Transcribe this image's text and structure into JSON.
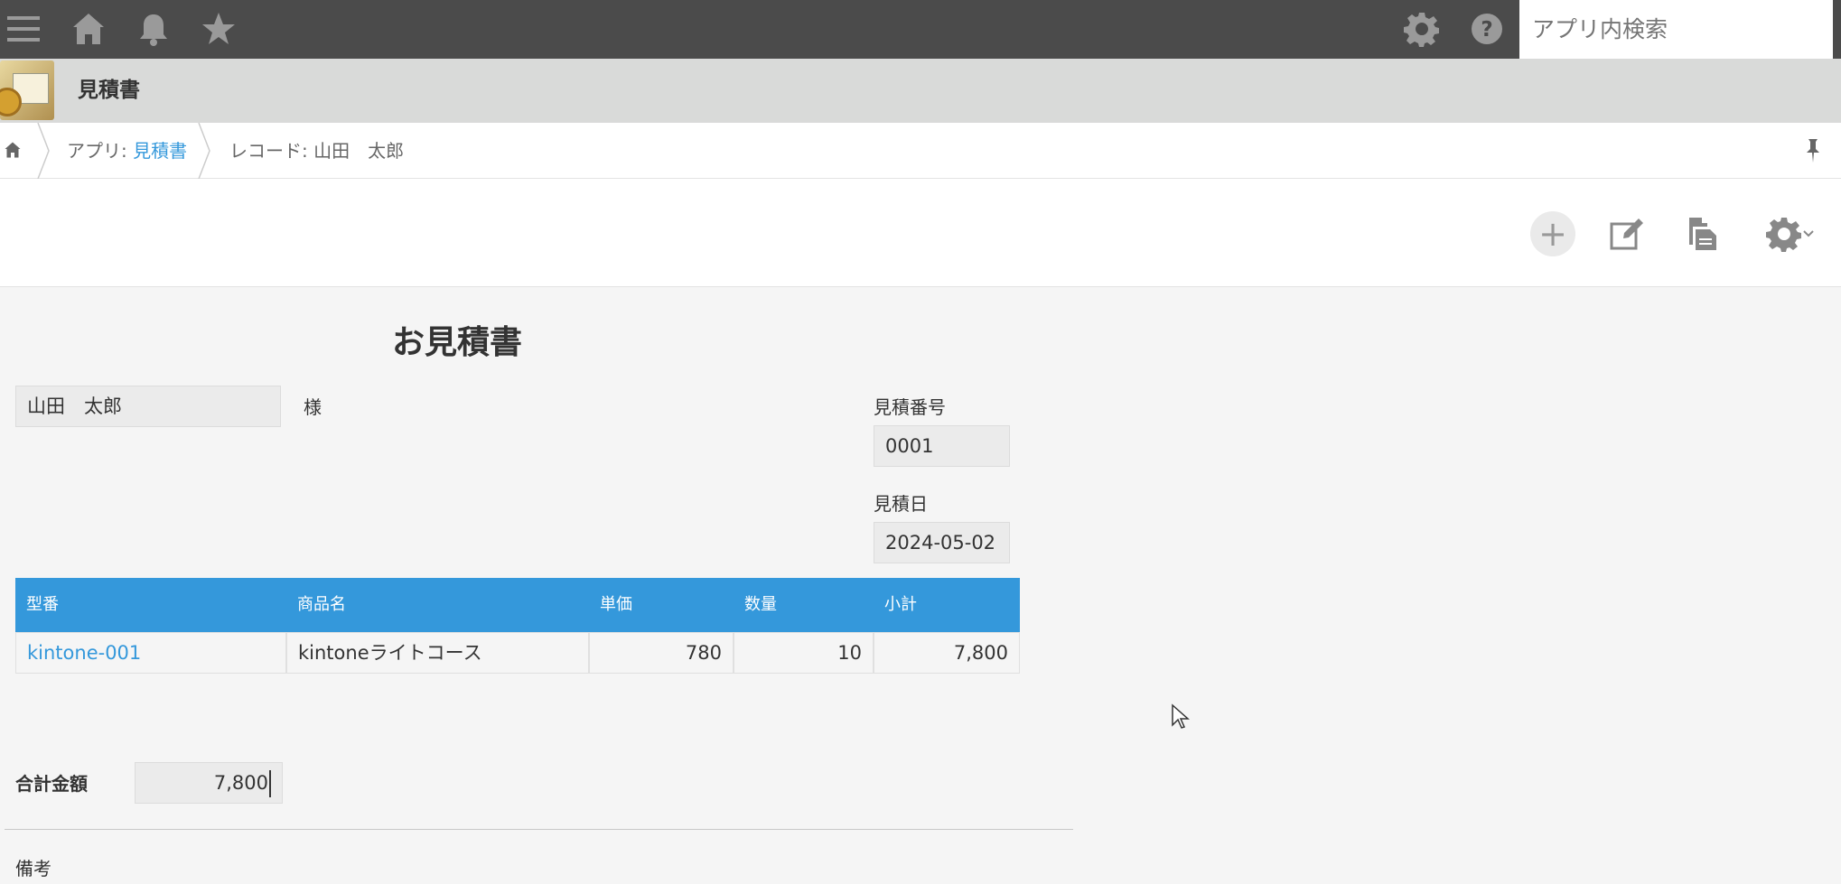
{
  "topbar": {
    "icons": [
      "menu-icon",
      "home-icon",
      "bell-icon",
      "star-icon",
      "gear-icon",
      "help-icon"
    ],
    "search_placeholder": "アプリ内検索"
  },
  "app": {
    "title": "見積書"
  },
  "breadcrumb": {
    "app_prefix": "アプリ: ",
    "app_name": "見積書",
    "record": "レコード: 山田　太郎"
  },
  "form": {
    "title": "お見積書",
    "customer_name": "山田　太郎",
    "honorific": "様",
    "quote_number_label": "見積番号",
    "quote_number": "0001",
    "quote_date_label": "見積日",
    "quote_date": "2024-05-02",
    "table": {
      "headers": [
        "型番",
        "商品名",
        "単価",
        "数量",
        "小計"
      ],
      "rows": [
        {
          "model": "kintone-001",
          "product": "kintoneライトコース",
          "unit_price": "780",
          "quantity": "10",
          "subtotal": "7,800"
        }
      ]
    },
    "total_label": "合計金額",
    "total_value": "7,800",
    "notes_label": "備考"
  },
  "colors": {
    "topbar": "#4b4b4b",
    "appbar": "#d9dad9",
    "accent": "#3498db",
    "background": "#f5f5f5"
  }
}
